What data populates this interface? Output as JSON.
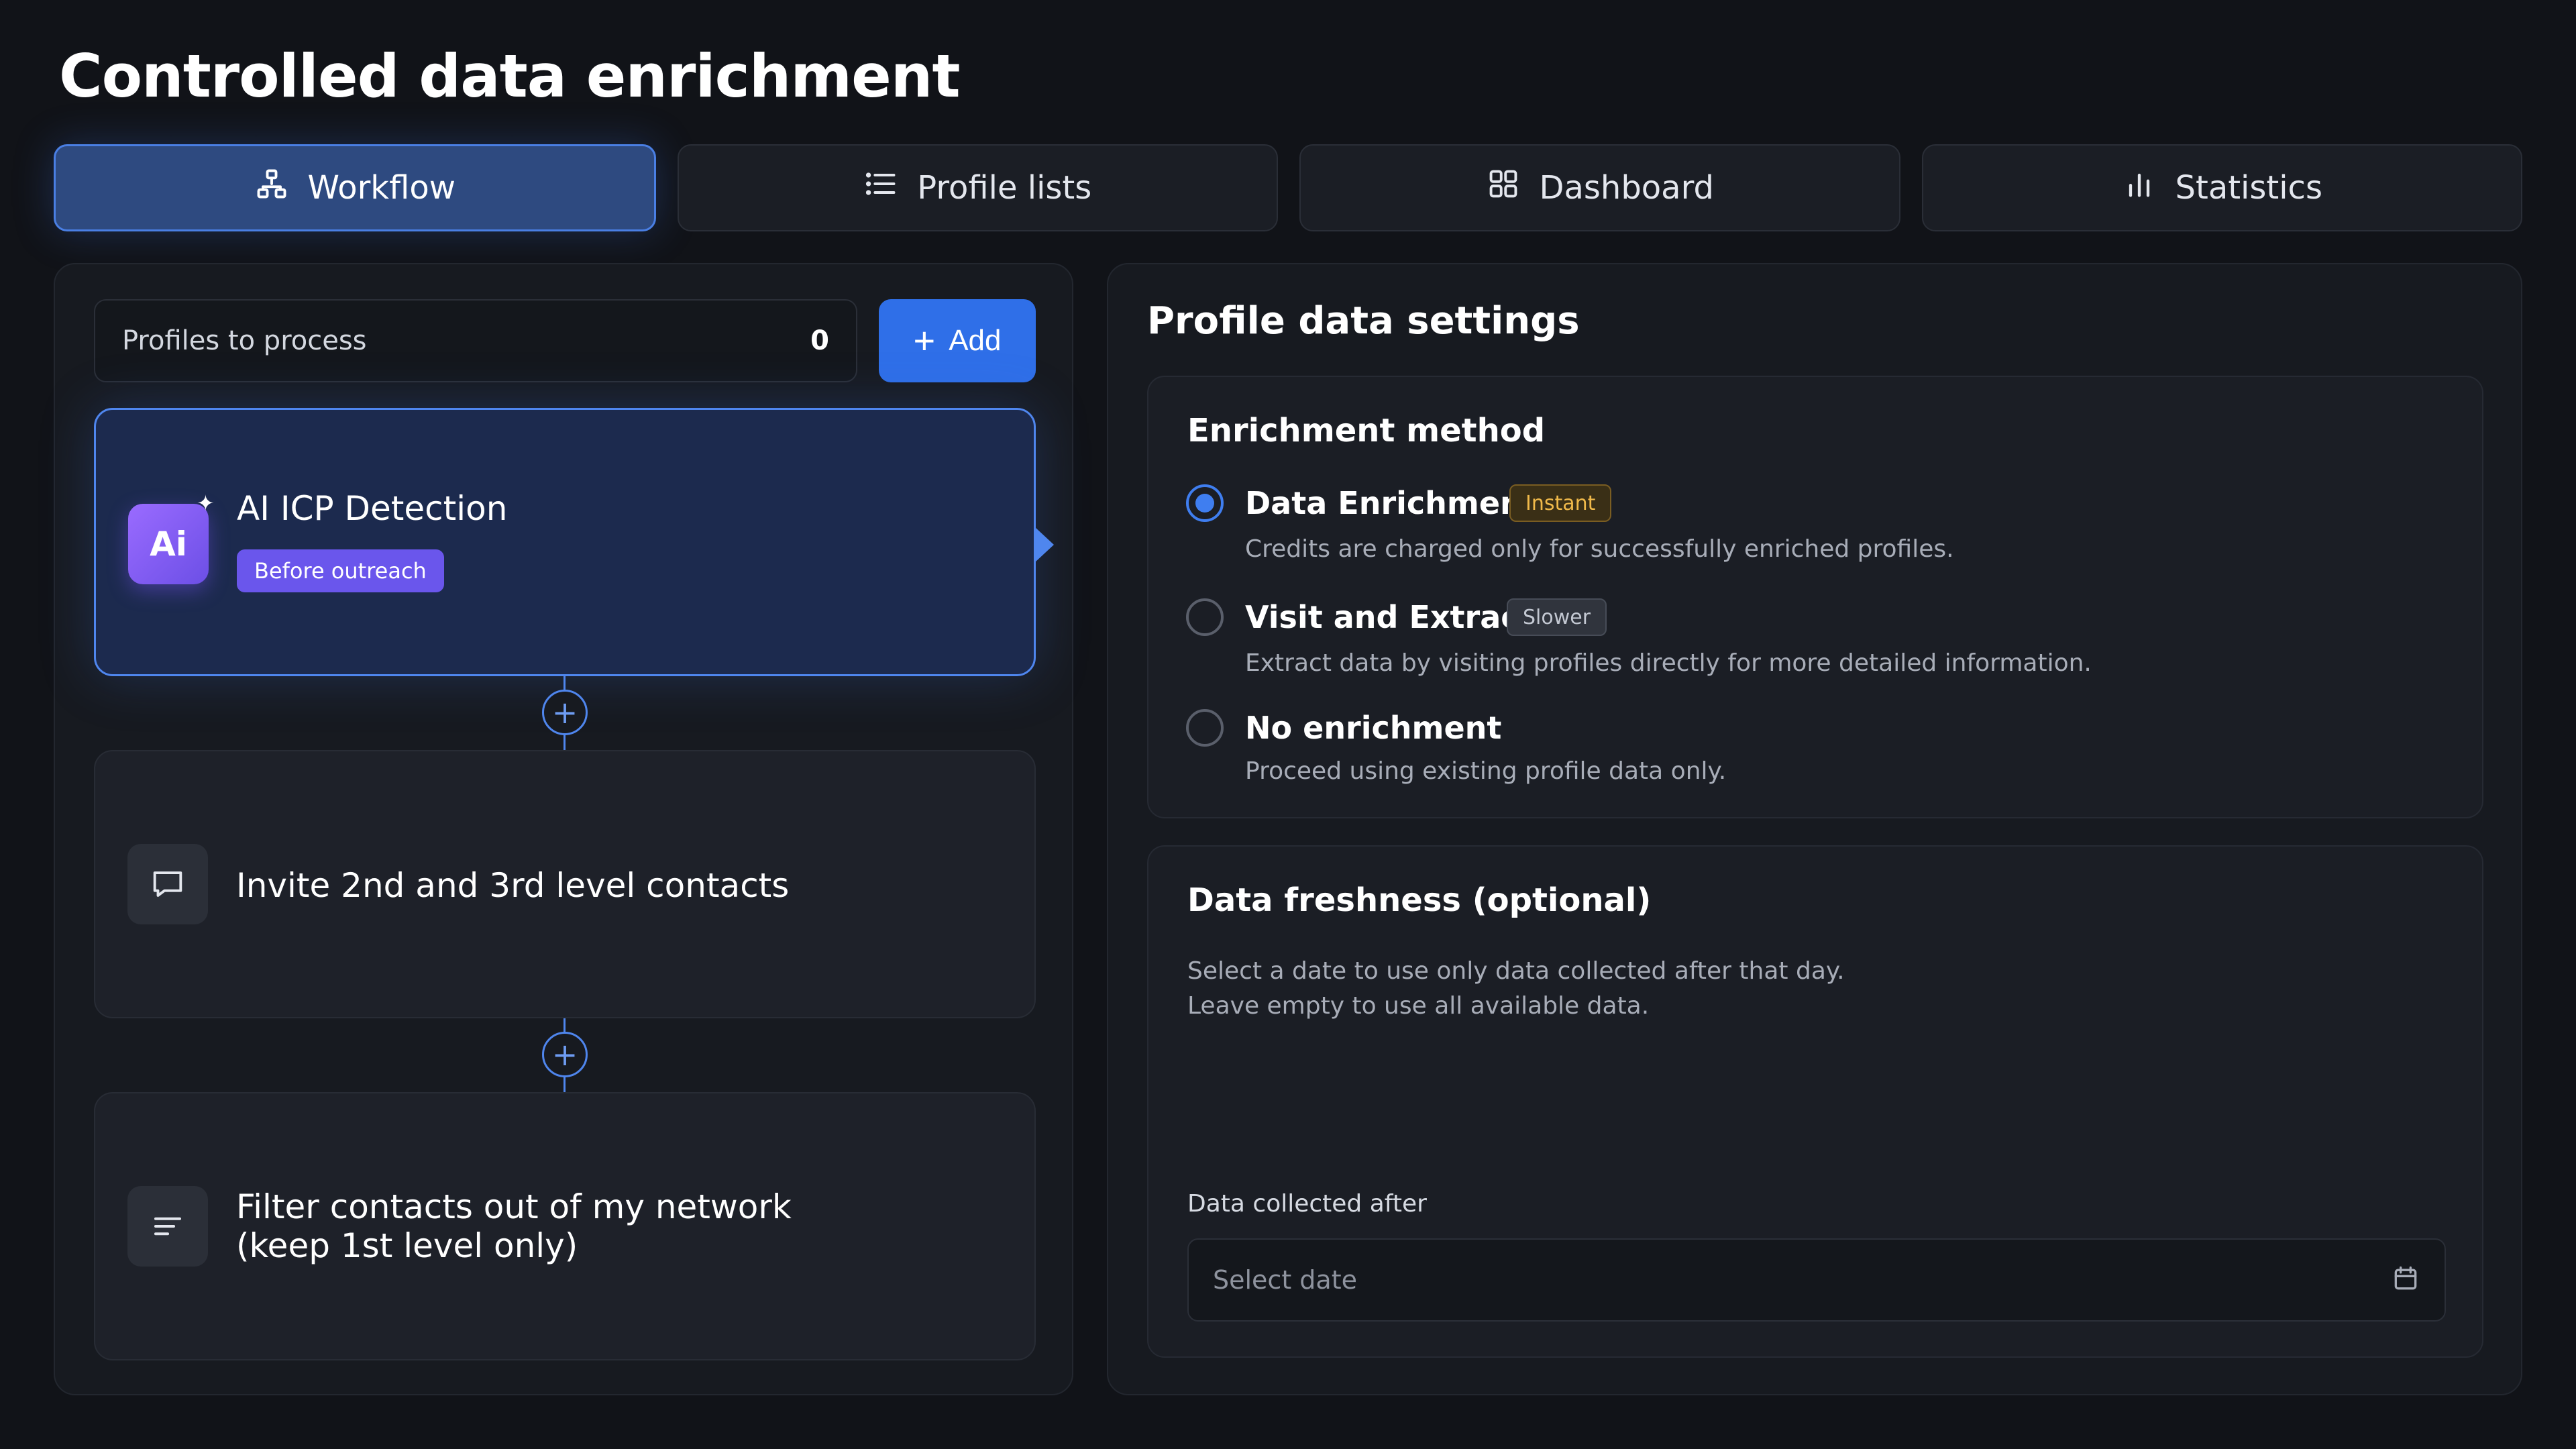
{
  "page": {
    "title": "Controlled data enrichment"
  },
  "tabs": [
    {
      "label": "Workflow",
      "icon": "workflow-icon",
      "active": true
    },
    {
      "label": "Profile lists",
      "icon": "list-icon",
      "active": false
    },
    {
      "label": "Dashboard",
      "icon": "dashboard-grid-icon",
      "active": false
    },
    {
      "label": "Statistics",
      "icon": "bar-chart-icon",
      "active": false
    }
  ],
  "workflow": {
    "profiles_label": "Profiles to process",
    "profiles_count": "0",
    "add_label": "Add",
    "steps": [
      {
        "title": "AI ICP Detection",
        "badge": "Before outreach",
        "icon": "ai-icon",
        "icon_text": "Ai",
        "active": true
      },
      {
        "title": "Invite 2nd and 3rd level contacts",
        "icon": "message-icon",
        "active": false
      },
      {
        "title_line1": "Filter contacts out of my network",
        "title_line2": "(keep 1st level only)",
        "icon": "filter-icon",
        "active": false
      }
    ]
  },
  "settings": {
    "title": "Profile data settings",
    "enrichment": {
      "title": "Enrichment method",
      "options": [
        {
          "label": "Data Enrichment",
          "pill": "Instant",
          "desc": "Credits are charged only for successfully enriched profiles.",
          "checked": true
        },
        {
          "label": "Visit and Extract",
          "pill": "Slower",
          "desc": "Extract data by visiting profiles directly for more detailed information.",
          "checked": false
        },
        {
          "label": "No enrichment",
          "desc": "Proceed using existing profile data only.",
          "checked": false
        }
      ]
    },
    "freshness": {
      "title": "Data freshness (optional)",
      "desc_line1": "Select a date to use only data collected after that day.",
      "desc_line2": "Leave empty to use all available data.",
      "date_label": "Data collected after",
      "date_placeholder": "Select date"
    }
  },
  "colors": {
    "accent": "#2f6fe8",
    "active_tab": "#2e4a80",
    "instant": "#f0b94a",
    "ai_purple": "#7c5cf0"
  }
}
